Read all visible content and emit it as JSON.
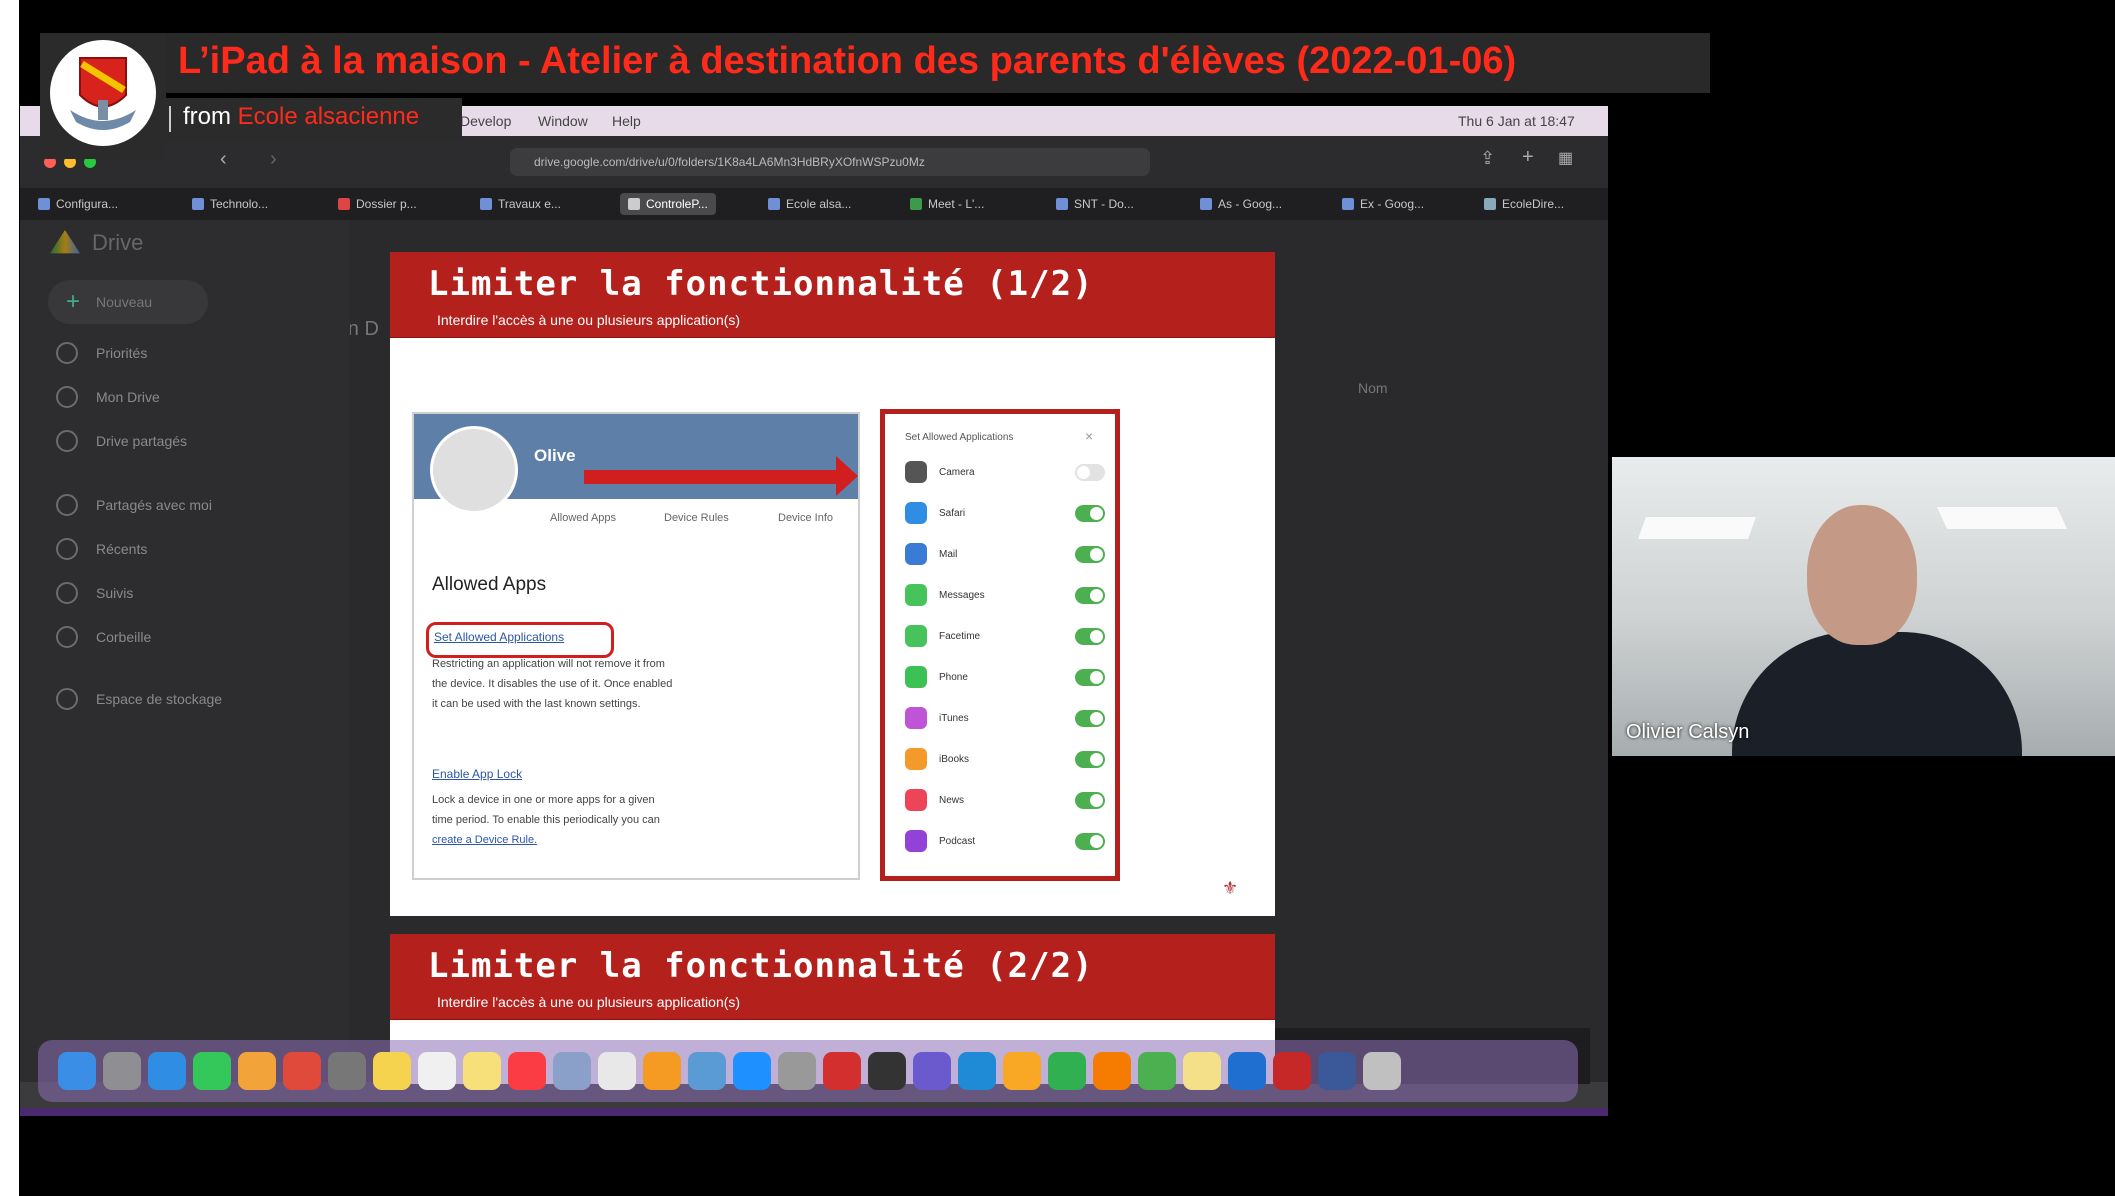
{
  "header": {
    "title": "L’iPad à la maison - Atelier à destination des parents d'élèves (2022-01-06)",
    "from_label": "from",
    "school_name": "Ecole alsacienne"
  },
  "colors": {
    "accent": "#ff2a1a",
    "slide_red": "#b4211c",
    "toggle_on": "#4caf50"
  },
  "mac_menubar": {
    "items": [
      "Develop",
      "Window",
      "Help"
    ],
    "clock": "Thu 6 Jan at 18:47"
  },
  "safari": {
    "url": "drive.google.com/drive/u/0/folders/1K8a4LA6Mn3HdBRyXOfnWSPzu0Mz",
    "tabs": [
      "Configura...",
      "Technolo...",
      "Dossier p...",
      "Travaux e...",
      "ControleP...",
      "Ecole alsa...",
      "Meet - L'...",
      "SNT - Do...",
      "As - Goog...",
      "Ex - Goog...",
      "EcoleDire..."
    ]
  },
  "drive": {
    "logo": "Drive",
    "new_button": "Nouveau",
    "nav_items": [
      "Priorités",
      "Mon Drive",
      "Drive partagés",
      "Partagés avec moi",
      "Récents",
      "Suivis",
      "Corbeille",
      "Espace de stockage"
    ],
    "my_drive_crumb": "Mon D",
    "sort_label": "Nom"
  },
  "slides": [
    {
      "title": "Limiter la fonctionnalité (1/2)",
      "subtitle": "Interdire l'accès à une ou plusieurs application(s)"
    },
    {
      "title": "Limiter la fonctionnalité (2/2)",
      "subtitle": "Interdire l'accès à une ou plusieurs application(s)"
    }
  ],
  "profile": {
    "name": "Olive",
    "tabs": [
      "Allowed Apps",
      "Device Rules",
      "Device Info"
    ],
    "heading": "Allowed Apps",
    "set_link": "Set Allowed Applications",
    "set_desc_lines": [
      "Restricting an application will not remove it from",
      "the device. It disables the use of it. Once enabled",
      "it can be used with the last known settings."
    ],
    "lock_link": "Enable App Lock",
    "lock_desc_lines": [
      "Lock a device in one or more apps for a given",
      "time period. To enable this periodically you can"
    ],
    "rule_link": "create a Device Rule."
  },
  "app_panel": {
    "title": "Set Allowed Applications",
    "close": "×",
    "apps": [
      {
        "name": "Camera",
        "on": false,
        "color": "#555555"
      },
      {
        "name": "Safari",
        "on": true,
        "color": "#2f8de4"
      },
      {
        "name": "Mail",
        "on": true,
        "color": "#3a7bd5"
      },
      {
        "name": "Messages",
        "on": true,
        "color": "#46c35a"
      },
      {
        "name": "Facetime",
        "on": true,
        "color": "#46c35a"
      },
      {
        "name": "Phone",
        "on": true,
        "color": "#3cc155"
      },
      {
        "name": "iTunes",
        "on": true,
        "color": "#c054d6"
      },
      {
        "name": "iBooks",
        "on": true,
        "color": "#f39a2a"
      },
      {
        "name": "News",
        "on": true,
        "color": "#ee4458"
      },
      {
        "name": "Podcast",
        "on": true,
        "color": "#9342d8"
      }
    ]
  },
  "webcam": {
    "participant_name": "Olivier Calsyn"
  },
  "dock_icons": [
    "finder-icon",
    "launchpad-icon",
    "safari-icon",
    "facetime-icon",
    "photos-icon",
    "photobooth-icon",
    "system-prefs-icon",
    "notes-icon",
    "calendar-icon",
    "stickies-icon",
    "music-icon",
    "keynote-icon",
    "chrome-icon",
    "pages-icon",
    "preview-icon",
    "app-store-icon",
    "utility-icon",
    "acrobat-icon",
    "terminal-icon",
    "imovie-icon",
    "keynote2-icon",
    "sketch-icon",
    "numbers-icon",
    "blender-icon",
    "app-icon",
    "notes2-icon",
    "outlook-icon",
    "filezilla-icon",
    "screens-icon",
    "trash-icon"
  ]
}
